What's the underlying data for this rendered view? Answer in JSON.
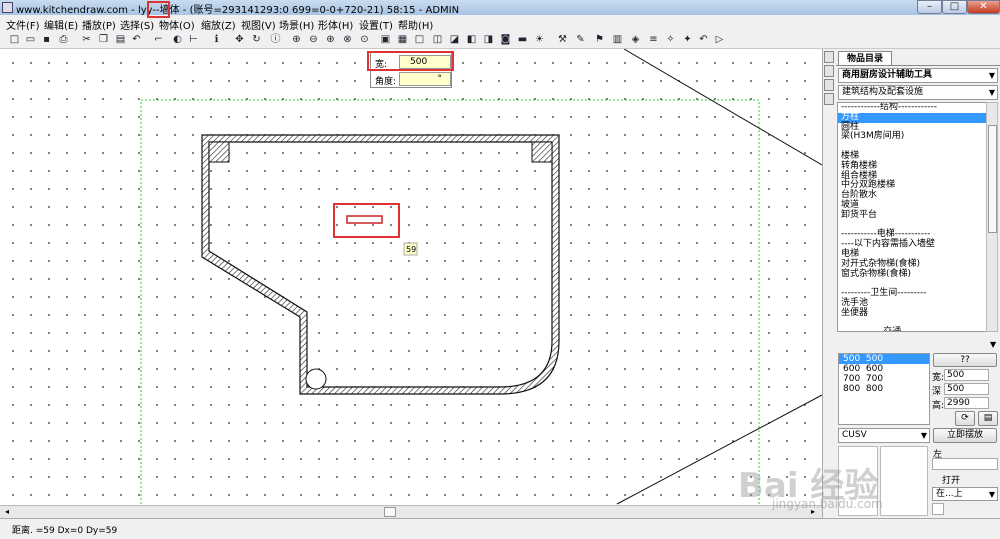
{
  "window": {
    "title": "www.kitchendraw.com - lyy--墙体 - (账号=293141293:0 699=0-0+720-21) 58:15 - ADMIN",
    "min_label": "–",
    "max_label": "□",
    "close_label": "✕"
  },
  "menu": [
    "文件(F)",
    "编辑(E)",
    "播放(P)",
    "选择(S)",
    "物体(O)",
    "缩放(Z)",
    "视图(V)",
    "场景(H)",
    "形体(H)",
    "设置(T)",
    "帮助(H)"
  ],
  "input_box": {
    "width_label": "宽:",
    "width_value": "500",
    "angle_label": "角度:",
    "angle_value": "°"
  },
  "canvas": {
    "dim_tag": "59"
  },
  "panel": {
    "tab_label": "物品目录",
    "catalog": "商用厨房设计辅助工具",
    "category": "建筑结构及配套设施",
    "items": [
      "------------结构------------",
      "方柱",
      "圆柱",
      "梁(H3M房间用)",
      "",
      "楼梯",
      "转角楼梯",
      "组合楼梯",
      "中分双跑楼梯",
      "台阶散水",
      "坡道",
      "卸货平台",
      "",
      "-----------电梯-----------",
      "----以下内容需插入墙壁",
      "电梯",
      "对开式杂物梯(食梯)",
      "窗式杂物梯(食梯)",
      "",
      "---------卫生间---------",
      "洗手池",
      "坐便器",
      "",
      "-------------交通-----------"
    ],
    "selected_item_index": 1,
    "sizes": [
      "500  500",
      "600  600",
      "700  700",
      "800  800"
    ],
    "selected_size_index": 0,
    "help_button": "??",
    "width_label": "宽:",
    "width_value": "500",
    "depth_label": "深",
    "depth_value": "500",
    "height_label": "高:",
    "height_value": "2990",
    "option_value": "CUSV",
    "place_button": "立即摆放",
    "left_label": "左",
    "open_label": "打开",
    "position_value": "在...上"
  },
  "status": {
    "text": "距离. =59 Dx=0 Dy=59"
  },
  "watermark": {
    "text": "Bai 经验",
    "url": "jingyan.baidu.com"
  },
  "colors": {
    "highlight": "#dd3333",
    "selection": "#3399ff",
    "dashed_boundary": "#33cc33"
  }
}
